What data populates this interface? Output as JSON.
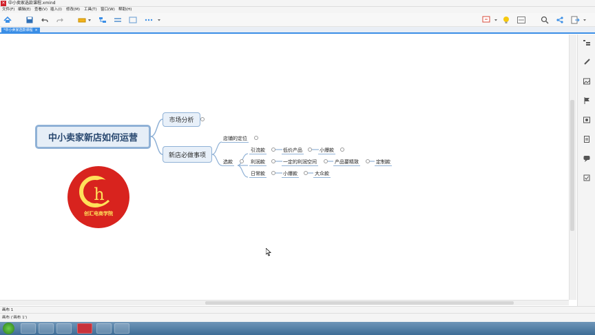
{
  "window": {
    "title": "中小卖家选款课程.xmind",
    "app_icon": "xmind-icon"
  },
  "menu": [
    "文件(F)",
    "编辑(E)",
    "查看(V)",
    "插入(I)",
    "修改(M)",
    "工具(T)",
    "窗口(W)",
    "帮助(H)"
  ],
  "doc_tab": {
    "label": "*中小卖家选款课程",
    "close": "×"
  },
  "mindmap": {
    "central": "中小卖家新店如何运营",
    "market": "市场分析",
    "must_do": "新店必做事项",
    "shop_position": "店铺的定位",
    "select": "选款",
    "yinliu": "引流款",
    "lowprice": "低价产品",
    "small_hit": "小爆款",
    "profit": "利润款",
    "margin_space": "一定的利润空间",
    "refined": "产品要精致",
    "custom": "定制款",
    "daily": "日常款",
    "small_hit2": "小爆款",
    "mass": "大众款"
  },
  "logo": {
    "letters": "创汇电商学院",
    "accent": "#d8231e",
    "ring": "#ffe15a"
  },
  "sheet_bar": {
    "tab": "画布 1"
  },
  "status": {
    "text": "画布 ('画布 1')"
  },
  "colors": {
    "accent": "#3a8ee6",
    "node_border": "#8fb1d6"
  }
}
